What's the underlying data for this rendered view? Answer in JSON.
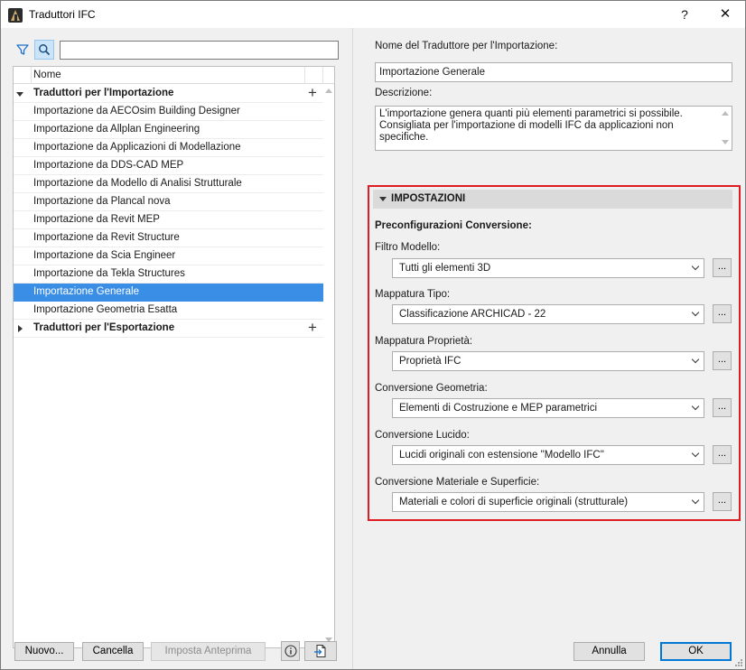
{
  "window": {
    "title": "Traduttori IFC",
    "help_label": "?",
    "close_label": "✕"
  },
  "left": {
    "search_value": "",
    "column_name": "Nome",
    "groups": [
      {
        "label": "Traduttori per l'Importazione",
        "expanded": true,
        "items": [
          "Importazione da AECOsim Building Designer",
          "Importazione da Allplan Engineering",
          "Importazione da Applicazioni di Modellazione",
          "Importazione da DDS-CAD MEP",
          "Importazione da Modello di Analisi Strutturale",
          "Importazione da Plancal nova",
          "Importazione da Revit MEP",
          "Importazione da Revit Structure",
          "Importazione da Scia Engineer",
          "Importazione da Tekla Structures",
          "Importazione Generale",
          "Importazione Geometria Esatta"
        ],
        "selected": "Importazione Generale"
      },
      {
        "label": "Traduttori per l'Esportazione",
        "expanded": false,
        "items": []
      }
    ],
    "buttons": {
      "new": "Nuovo...",
      "cancel": "Cancella",
      "preview": "Imposta Anteprima"
    }
  },
  "right": {
    "name_label": "Nome del Traduttore per l'Importazione:",
    "name_value": "Importazione Generale",
    "desc_label": "Descrizione:",
    "desc_value": "L'importazione genera quanti più elementi parametrici si possibile.\nConsigliata per l'importazione di modelli IFC da applicazioni non\nspecifiche.",
    "settings_title": "IMPOSTAZIONI",
    "preconf_label": "Preconfigurazioni Conversione:",
    "fields": [
      {
        "label": "Filtro Modello:",
        "value": "Tutti gli elementi 3D"
      },
      {
        "label": "Mappatura Tipo:",
        "value": "Classificazione ARCHICAD - 22"
      },
      {
        "label": "Mappatura Proprietà:",
        "value": "Proprietà IFC"
      },
      {
        "label": "Conversione Geometria:",
        "value": "Elementi di Costruzione e MEP parametrici"
      },
      {
        "label": "Conversione Lucido:",
        "value": "Lucidi originali con estensione \"Modello IFC\""
      },
      {
        "label": "Conversione Materiale e Superficie:",
        "value": "Materiali e colori di superficie originali (strutturale)"
      }
    ],
    "dots_label": "...",
    "annulla": "Annulla",
    "ok": "OK"
  },
  "colors": {
    "selection": "#3a8ee6",
    "highlight_frame": "#e11b22",
    "default_button_border": "#0078d7"
  }
}
